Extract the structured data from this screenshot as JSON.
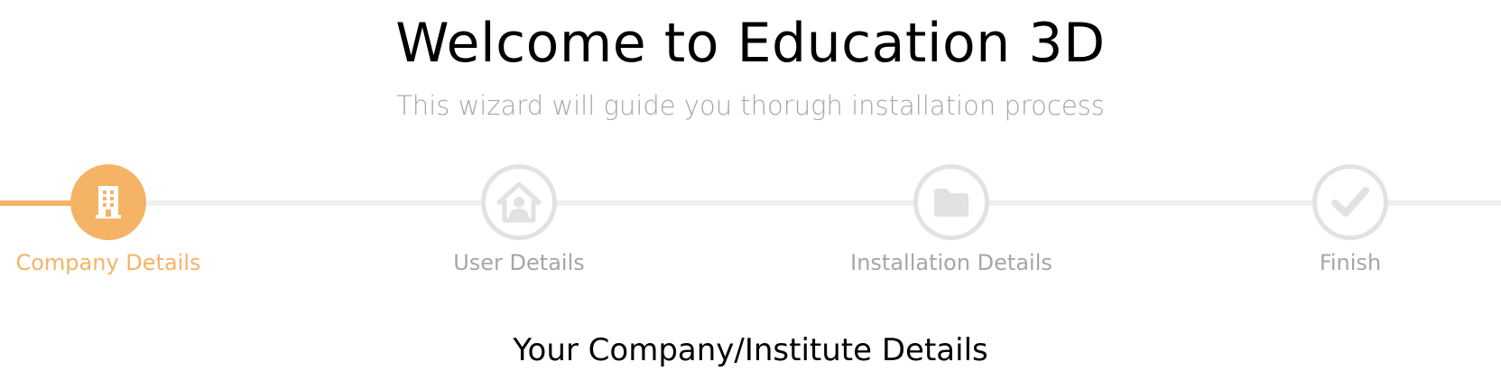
{
  "header": {
    "title": "Welcome to Education 3D",
    "subtitle": "This wizard will guide you thorugh installation process"
  },
  "wizard": {
    "accent_color": "#f5b366",
    "inactive_color": "#e2e2e2",
    "steps": [
      {
        "label": "Company Details",
        "icon": "building-icon",
        "state": "active"
      },
      {
        "label": "User Details",
        "icon": "user-home-icon",
        "state": "pending"
      },
      {
        "label": "Installation Details",
        "icon": "folder-icon",
        "state": "pending"
      },
      {
        "label": "Finish",
        "icon": "checkmark-icon",
        "state": "pending"
      }
    ]
  },
  "main": {
    "section_heading": "Your Company/Institute Details"
  }
}
